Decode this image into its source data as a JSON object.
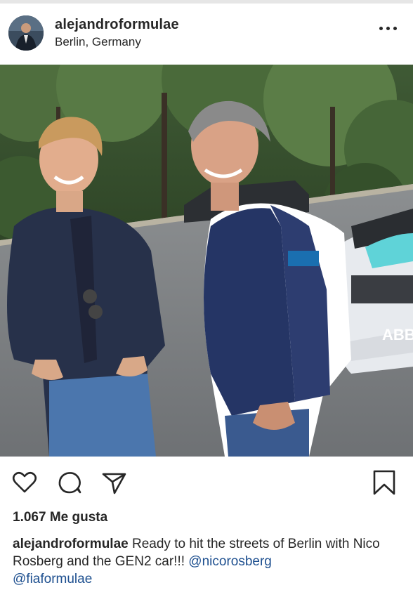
{
  "post": {
    "username": "alejandroformulae",
    "location": "Berlin, Germany",
    "more_icon": "more-horizontal-icon"
  },
  "photo": {
    "car_sponsor": "ABB",
    "badge_text": "ABB"
  },
  "actions": {
    "like_icon": "heart-icon",
    "comment_icon": "comment-icon",
    "share_icon": "send-icon",
    "save_icon": "bookmark-icon"
  },
  "likes": {
    "text": "1.067 Me gusta"
  },
  "caption": {
    "username": "alejandroformulae",
    "text": " Ready to hit the streets of Berlin with Nico Rosberg and the GEN2 car!!! ",
    "mention_1": "@nicorosberg",
    "mention_2": "@fiaformulae"
  },
  "colors": {
    "text": "#262626",
    "mention": "#1d4f8f"
  }
}
